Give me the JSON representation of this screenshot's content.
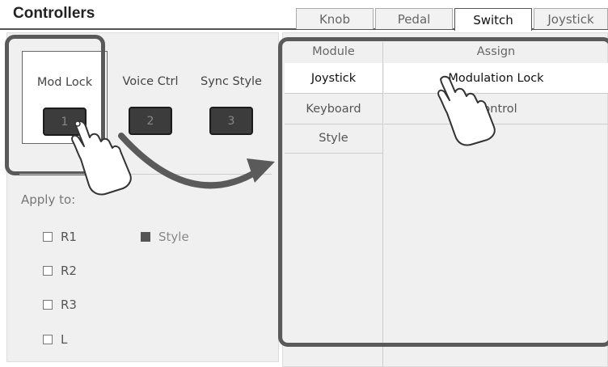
{
  "header": {
    "title": "Controllers",
    "tabs": [
      {
        "label": "Knob",
        "active": false
      },
      {
        "label": "Pedal",
        "active": false
      },
      {
        "label": "Switch",
        "active": true
      },
      {
        "label": "Joystick",
        "active": false
      }
    ]
  },
  "switches": [
    {
      "label": "Mod Lock",
      "button": "1",
      "selected": true
    },
    {
      "label": "Voice Ctrl",
      "button": "2",
      "selected": false
    },
    {
      "label": "Sync Style",
      "button": "3",
      "selected": false
    }
  ],
  "apply_to": {
    "label": "Apply to:",
    "options": [
      {
        "label": "R1",
        "checked": false
      },
      {
        "label": "R2",
        "checked": false
      },
      {
        "label": "R3",
        "checked": false
      },
      {
        "label": "L",
        "checked": false
      },
      {
        "label": "Style",
        "checked": true
      }
    ]
  },
  "assign_table": {
    "module_header": "Module",
    "assign_header": "Assign",
    "modules": [
      "Joystick",
      "Keyboard",
      "Style"
    ],
    "assigns": [
      "Modulation Lock",
      "Control"
    ],
    "selected_module": "Joystick",
    "selected_assign": "Modulation Lock"
  },
  "colors": {
    "highlight_border": "#5a5a5a",
    "button_fill": "#3c3c3c",
    "panel_bg": "#f0f0f0"
  }
}
